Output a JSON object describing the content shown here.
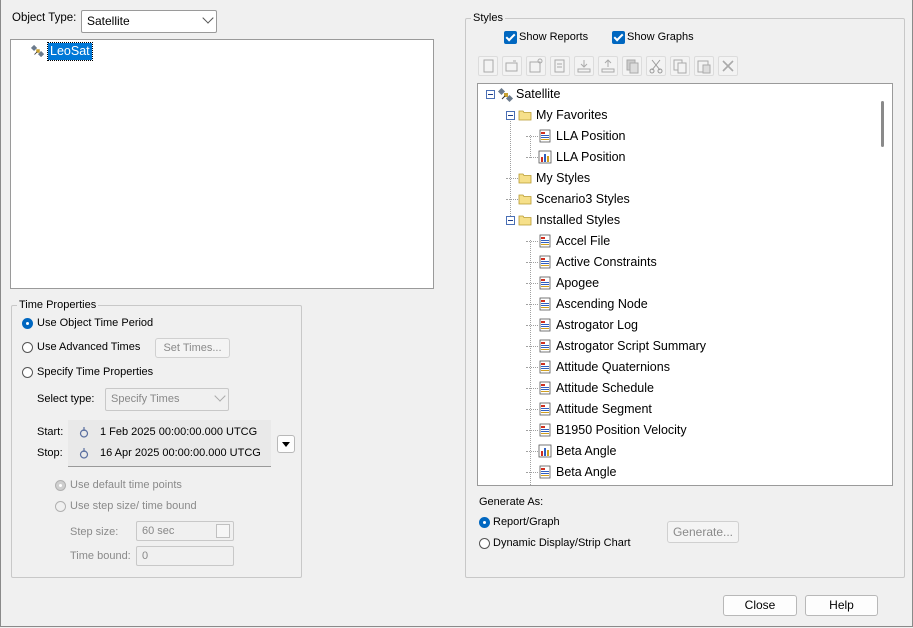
{
  "object_type": {
    "label": "Object Type:",
    "value": "Satellite"
  },
  "objects": [
    {
      "name": "LeoSat",
      "icon": "satellite-icon"
    }
  ],
  "time_properties": {
    "title": "Time Properties",
    "use_object_time_period": "Use Object Time Period",
    "use_advanced_times": "Use Advanced Times",
    "set_times_button": "Set Times...",
    "specify_time_properties": "Specify Time Properties",
    "select_type_label": "Select type:",
    "select_type_value": "Specify Times",
    "start_label": "Start:",
    "start_value": "1 Feb 2025 00:00:00.000 UTCG",
    "stop_label": "Stop:",
    "stop_value": "16 Apr 2025 00:00:00.000 UTCG",
    "use_default_time_points": "Use default time points",
    "use_step_size": "Use step size/ time bound",
    "step_size_label": "Step size:",
    "step_size_value": "60 sec",
    "time_bound_label": "Time bound:",
    "time_bound_value": "0",
    "selected_option": "use_object_time_period"
  },
  "styles": {
    "title": "Styles",
    "show_reports": "Show Reports",
    "show_reports_checked": true,
    "show_graphs": "Show Graphs",
    "show_graphs_checked": true,
    "toolbar_icons": [
      "new-icon",
      "new-folder-icon",
      "properties-icon",
      "duplicate-icon",
      "import-icon",
      "export-icon",
      "copy-icon",
      "cut-icon",
      "copy-icon",
      "paste-icon",
      "delete-icon"
    ],
    "tree": {
      "root": "Satellite",
      "favorites_folder": "My Favorites",
      "favorites": [
        {
          "label": "LLA Position",
          "kind": "report"
        },
        {
          "label": "LLA Position",
          "kind": "graph"
        }
      ],
      "my_styles": "My Styles",
      "scenario_styles": "Scenario3 Styles",
      "installed_folder": "Installed Styles",
      "installed": [
        {
          "label": "Accel File",
          "kind": "report"
        },
        {
          "label": "Active Constraints",
          "kind": "report"
        },
        {
          "label": "Apogee",
          "kind": "report"
        },
        {
          "label": "Ascending Node",
          "kind": "report"
        },
        {
          "label": "Astrogator Log",
          "kind": "report"
        },
        {
          "label": "Astrogator Script Summary",
          "kind": "report"
        },
        {
          "label": "Attitude Quaternions",
          "kind": "report"
        },
        {
          "label": "Attitude Schedule",
          "kind": "report"
        },
        {
          "label": "Attitude Segment",
          "kind": "report"
        },
        {
          "label": "B1950 Position Velocity",
          "kind": "report"
        },
        {
          "label": "Beta Angle",
          "kind": "graph"
        },
        {
          "label": "Beta Angle",
          "kind": "report"
        }
      ]
    }
  },
  "generate_as": {
    "title": "Generate As:",
    "report_graph": "Report/Graph",
    "dynamic_display": "Dynamic Display/Strip Chart",
    "selected": "report_graph",
    "generate_button": "Generate..."
  },
  "footer": {
    "close": "Close",
    "help": "Help"
  },
  "colors": {
    "accent": "#0067c0",
    "selection": "#0078d7"
  }
}
